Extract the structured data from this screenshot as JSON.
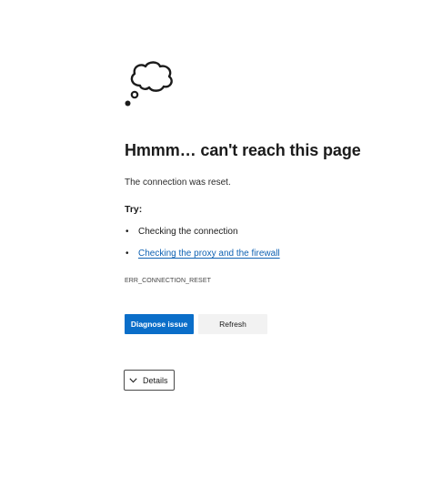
{
  "error": {
    "title": "Hmmm… can't reach this page",
    "message": "The connection was reset.",
    "try_heading": "Try:",
    "suggestions": [
      {
        "label": "Checking the connection",
        "is_link": false
      },
      {
        "label": "Checking the proxy and the firewall",
        "is_link": true
      }
    ],
    "code": "ERR_CONNECTION_RESET"
  },
  "actions": {
    "diagnose_label": "Diagnose issue",
    "refresh_label": "Refresh",
    "details_label": "Details"
  },
  "icons": {
    "main": "thought-cloud-icon",
    "details": "chevron-down-icon"
  },
  "colors": {
    "primary_button": "#0a6ec9",
    "link": "#0f62b3",
    "secondary_button": "#f2f2f2"
  }
}
